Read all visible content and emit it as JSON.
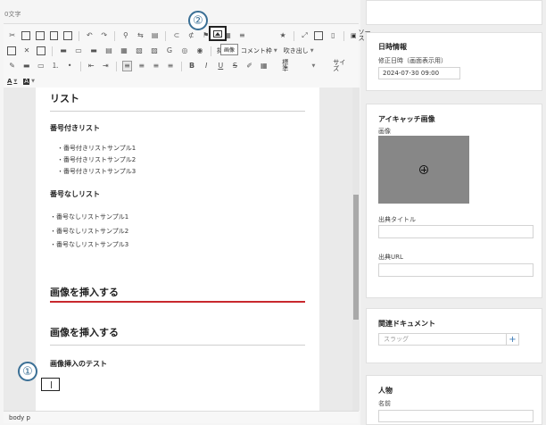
{
  "editor": {
    "char_count": "0文字",
    "toolbar": {
      "source_label": "ソース",
      "insert_label": "挿入",
      "comment_label": "コメント枠",
      "speech_label": "吹き出し",
      "format_label": "標準",
      "size_label": "サイズ",
      "image_tooltip": "画像",
      "bold": "B",
      "italic": "I",
      "underline": "U",
      "strike": "S",
      "text_color": "A",
      "bg_color": "A"
    },
    "callouts": {
      "image_button": "②",
      "cursor": "①"
    },
    "content": {
      "list_heading": "リスト",
      "numbered_heading": "番号付きリスト",
      "numbered_items": [
        "番号付きリストサンプル1",
        "番号付きリストサンプル2",
        "番号付きリストサンプル3"
      ],
      "bullet_heading": "番号なしリスト",
      "bullet_items": [
        "番号なしリストサンプル1",
        "番号なしリストサンプル2",
        "番号なしリストサンプル3"
      ],
      "image_heading_h2": "画像を挿入する",
      "image_heading_h3": "画像を挿入する",
      "image_test": "画像挿入のテスト"
    },
    "status_path": "body  p"
  },
  "sidebar": {
    "datetime": {
      "title": "日時情報",
      "label": "修正日時（画面表示用）",
      "value": "2024-07-30 09:00"
    },
    "eyecatch": {
      "title": "アイキャッチ画像",
      "image_label": "画像",
      "source_title_label": "出典タイトル",
      "source_url_label": "出典URL"
    },
    "related": {
      "title": "関連ドキュメント",
      "slug_placeholder": "スラッグ",
      "add_label": "+"
    },
    "person": {
      "title": "人物",
      "name_label": "名前"
    }
  }
}
